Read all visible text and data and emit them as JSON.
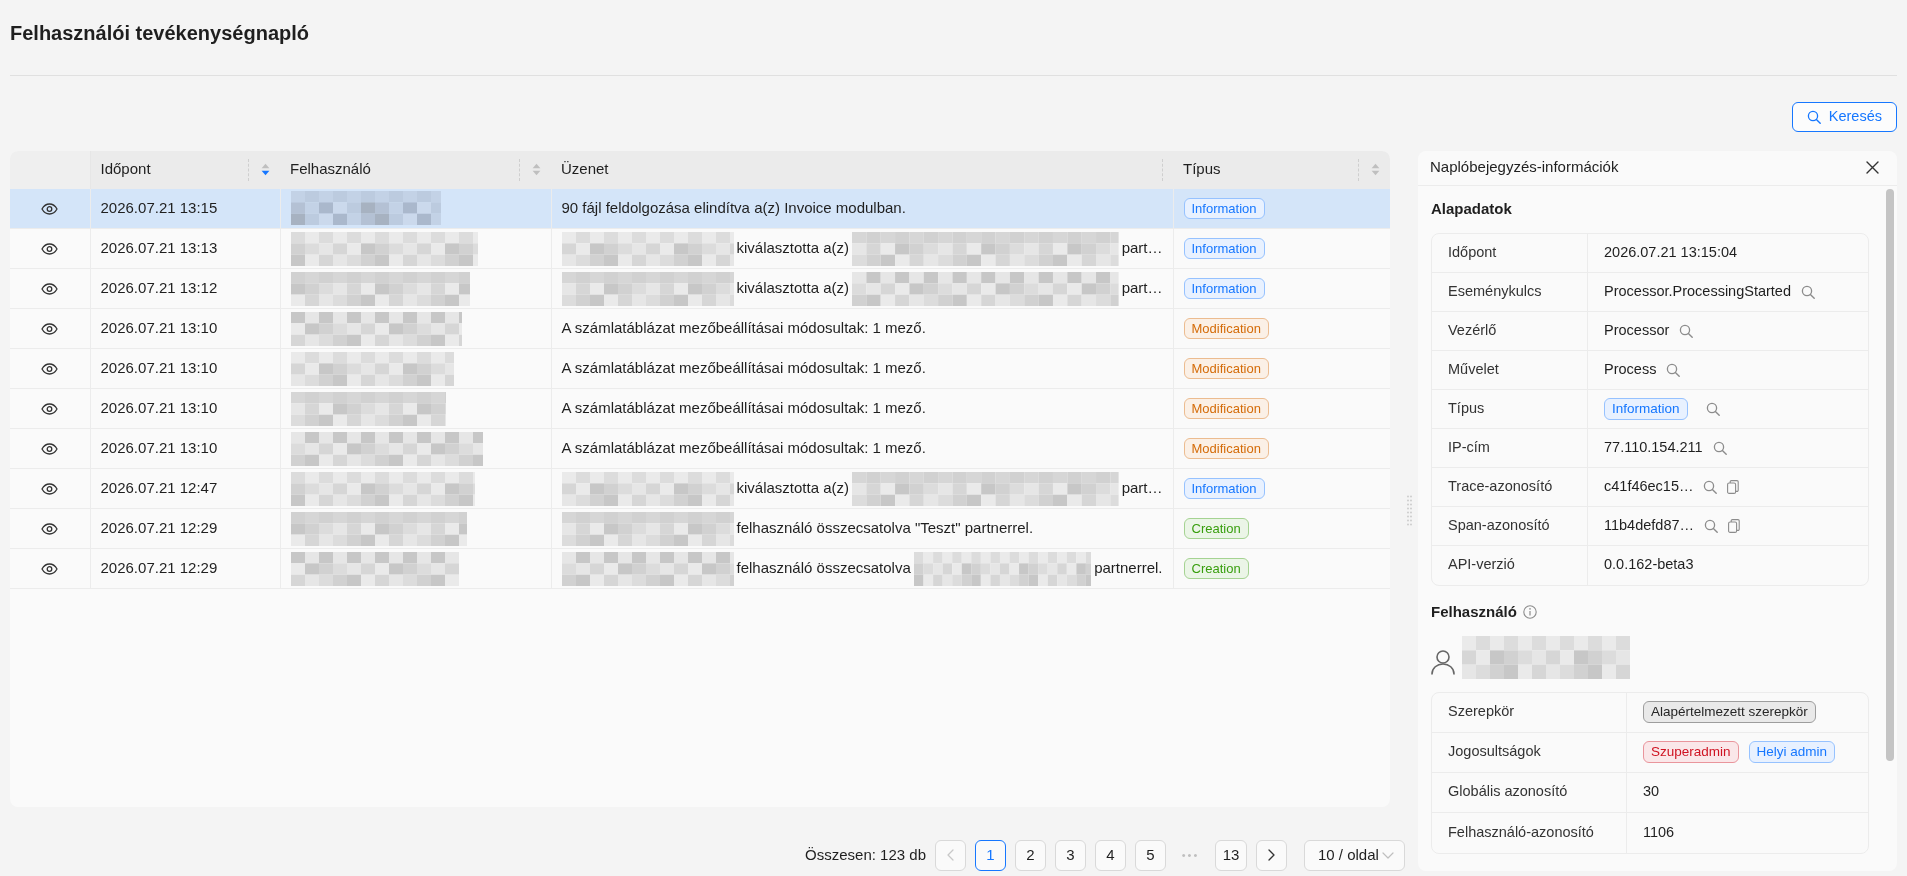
{
  "page": {
    "title": "Felhasználói tevékenységnapló",
    "search_button": "Keresés"
  },
  "table": {
    "columns": [
      {
        "label": "Időpont",
        "sortable": true,
        "sort_descending": true
      },
      {
        "label": "Felhasználó",
        "sortable": true,
        "sort_descending": false
      },
      {
        "label": "Üzenet",
        "sortable": false
      },
      {
        "label": "Típus",
        "sortable": true,
        "sort_descending": false
      }
    ],
    "rows": [
      {
        "selected": true,
        "time": "2026.07.21 13:15",
        "user": [
          {
            "kind": "redacted"
          }
        ],
        "message": [
          {
            "kind": "text",
            "text": "90 fájl feldolgozása elindítva a(z) Invoice modulban."
          }
        ],
        "type": {
          "label": "Information",
          "color": "#1677ff"
        }
      },
      {
        "selected": false,
        "time": "2026.07.21 13:13",
        "user": [
          {
            "kind": "redacted"
          }
        ],
        "message": [
          {
            "kind": "redacted"
          },
          {
            "kind": "text",
            "text": "kiválasztotta a(z)"
          },
          {
            "kind": "redacted"
          },
          {
            "kind": "text",
            "text": "part…"
          }
        ],
        "type": {
          "label": "Information",
          "color": "#1677ff"
        }
      },
      {
        "selected": false,
        "time": "2026.07.21 13:12",
        "user": [
          {
            "kind": "redacted"
          }
        ],
        "message": [
          {
            "kind": "redacted"
          },
          {
            "kind": "text",
            "text": "kiválasztotta a(z)"
          },
          {
            "kind": "redacted"
          },
          {
            "kind": "text",
            "text": "part…"
          }
        ],
        "type": {
          "label": "Information",
          "color": "#1677ff"
        }
      },
      {
        "selected": false,
        "time": "2026.07.21 13:10",
        "user": [
          {
            "kind": "redacted"
          }
        ],
        "message": [
          {
            "kind": "text",
            "text": "A számlatáblázat mezőbeállításai módosultak: 1 mező."
          }
        ],
        "type": {
          "label": "Modification",
          "color": "#d46b08"
        }
      },
      {
        "selected": false,
        "time": "2026.07.21 13:10",
        "user": [
          {
            "kind": "redacted"
          }
        ],
        "message": [
          {
            "kind": "text",
            "text": "A számlatáblázat mezőbeállításai módosultak: 1 mező."
          }
        ],
        "type": {
          "label": "Modification",
          "color": "#d46b08"
        }
      },
      {
        "selected": false,
        "time": "2026.07.21 13:10",
        "user": [
          {
            "kind": "redacted"
          }
        ],
        "message": [
          {
            "kind": "text",
            "text": "A számlatáblázat mezőbeállításai módosultak: 1 mező."
          }
        ],
        "type": {
          "label": "Modification",
          "color": "#d46b08"
        }
      },
      {
        "selected": false,
        "time": "2026.07.21 13:10",
        "user": [
          {
            "kind": "redacted"
          }
        ],
        "message": [
          {
            "kind": "text",
            "text": "A számlatáblázat mezőbeállításai módosultak: 1 mező."
          }
        ],
        "type": {
          "label": "Modification",
          "color": "#d46b08"
        }
      },
      {
        "selected": false,
        "time": "2026.07.21 12:47",
        "user": [
          {
            "kind": "redacted"
          }
        ],
        "message": [
          {
            "kind": "redacted"
          },
          {
            "kind": "text",
            "text": "kiválasztotta a(z)"
          },
          {
            "kind": "redacted"
          },
          {
            "kind": "text",
            "text": "part…"
          }
        ],
        "type": {
          "label": "Information",
          "color": "#1677ff"
        }
      },
      {
        "selected": false,
        "time": "2026.07.21 12:29",
        "user": [
          {
            "kind": "redacted"
          }
        ],
        "message": [
          {
            "kind": "redacted"
          },
          {
            "kind": "text",
            "text": "felhasználó összecsatolva \"Teszt\" partnerrel."
          }
        ],
        "type": {
          "label": "Creation",
          "color": "#389e0d"
        }
      },
      {
        "selected": false,
        "time": "2026.07.21 12:29",
        "user": [
          {
            "kind": "redacted"
          }
        ],
        "message": [
          {
            "kind": "redacted"
          },
          {
            "kind": "text",
            "text": "felhasználó összecsatolva"
          },
          {
            "kind": "redacted"
          },
          {
            "kind": "text",
            "text": "partnerrel."
          }
        ],
        "type": {
          "label": "Creation",
          "color": "#389e0d"
        }
      }
    ]
  },
  "pagination": {
    "total": "Összesen: 123 db",
    "prev": {
      "disabled": true
    },
    "pages": [
      {
        "kind": "page",
        "label": "1",
        "selected": true
      },
      {
        "kind": "page",
        "label": "2",
        "selected": false
      },
      {
        "kind": "page",
        "label": "3",
        "selected": false
      },
      {
        "kind": "page",
        "label": "4",
        "selected": false
      },
      {
        "kind": "page",
        "label": "5",
        "selected": false
      },
      {
        "kind": "ellipsis",
        "label": "•••",
        "selected": false
      },
      {
        "kind": "page",
        "label": "13",
        "selected": false
      }
    ],
    "next": {
      "disabled": false
    },
    "page_size": "10 / oldal"
  },
  "detail_panel": {
    "title": "Naplóbejegyzés-információk",
    "basic": {
      "heading": "Alapadatok",
      "fields": [
        {
          "label": "Időpont",
          "kind": "text",
          "value": "2026.07.21 13:15:04",
          "filter": false,
          "copy": false
        },
        {
          "label": "Eseménykulcs",
          "kind": "text",
          "value": "Processor.ProcessingStarted",
          "filter": true,
          "copy": false
        },
        {
          "label": "Vezérlő",
          "kind": "text",
          "value": "Processor",
          "filter": true,
          "copy": false
        },
        {
          "label": "Művelet",
          "kind": "text",
          "value": "Process",
          "filter": true,
          "copy": false
        },
        {
          "label": "Típus",
          "kind": "tag",
          "value": "Information",
          "color": "#1677ff",
          "filter": true,
          "copy": false
        },
        {
          "label": "IP-cím",
          "kind": "text",
          "value": "77.110.154.211",
          "filter": true,
          "copy": false
        },
        {
          "label": "Trace-azonosító",
          "kind": "text",
          "value": "c41f46ec15…",
          "filter": true,
          "copy": true
        },
        {
          "label": "Span-azonosító",
          "kind": "text",
          "value": "11b4defd87…",
          "filter": true,
          "copy": true
        },
        {
          "label": "API-verzió",
          "kind": "text",
          "value": "0.0.162-beta3",
          "filter": false,
          "copy": false
        }
      ]
    },
    "user": {
      "heading": "Felhasználó",
      "name": [
        {
          "kind": "redacted"
        }
      ],
      "fields": [
        {
          "label": "Szerepkör",
          "kind": "tags",
          "tags": [
            {
              "label": "Alapértelmezett szerepkör",
              "color": "#262626"
            }
          ]
        },
        {
          "label": "Jogosultságok",
          "kind": "tags",
          "tags": [
            {
              "label": "Szuperadmin",
              "color": "#cf1322"
            },
            {
              "label": "Helyi admin",
              "color": "#1677ff"
            }
          ]
        },
        {
          "label": "Globális azonosító",
          "kind": "text",
          "value": "30"
        },
        {
          "label": "Felhasználó-azonosító",
          "kind": "text",
          "value": "1106"
        }
      ]
    }
  }
}
